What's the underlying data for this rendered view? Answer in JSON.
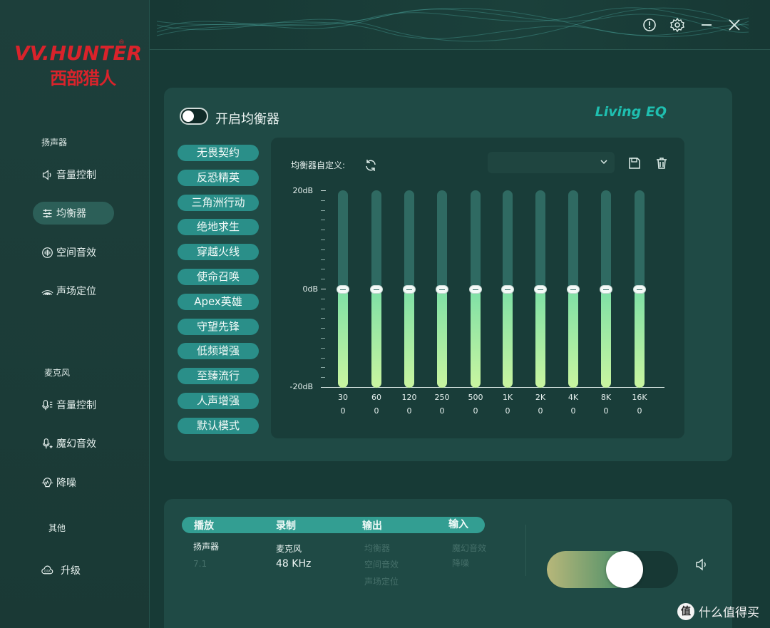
{
  "brand": {
    "logo_en": "VV.HUNTER",
    "logo_cn": "西部猎人",
    "logo_reg": "®",
    "color": "#d9232b"
  },
  "sidebar": {
    "speaker_section": "扬声器",
    "speaker_items": [
      {
        "label": "音量控制",
        "icon": "speaker-icon"
      },
      {
        "label": "均衡器",
        "icon": "equalizer-icon",
        "active": true
      },
      {
        "label": "空间音效",
        "icon": "spatial-audio-icon"
      },
      {
        "label": "声场定位",
        "icon": "sound-field-icon"
      }
    ],
    "mic_section": "麦克风",
    "mic_items": [
      {
        "label": "音量控制",
        "icon": "mic-volume-icon"
      },
      {
        "label": "魔幻音效",
        "icon": "magic-voice-icon"
      },
      {
        "label": "降噪",
        "icon": "noise-reduction-icon"
      }
    ],
    "other_section": "其他",
    "other_items": [
      {
        "label": "升级",
        "icon": "cloud-upgrade-icon"
      }
    ]
  },
  "topbar": {
    "icons": [
      "info-icon",
      "settings-icon",
      "minimize-icon",
      "close-icon"
    ]
  },
  "equalizer": {
    "enable_label": "开启均衡器",
    "enabled": false,
    "brand_label": "Living EQ",
    "presets": [
      "无畏契约",
      "反恐精英",
      "三角洲行动",
      "绝地求生",
      "穿越火线",
      "使命召唤",
      "Apex英雄",
      "守望先锋",
      "低频增强",
      "至臻流行",
      "人声增强",
      "默认模式"
    ],
    "custom_label": "均衡器自定义:",
    "custom_select_value": "",
    "db_max": "20dB",
    "db_mid": "0dB",
    "db_min": "-20dB",
    "bands": [
      {
        "freq": "30",
        "gain": "0"
      },
      {
        "freq": "60",
        "gain": "0"
      },
      {
        "freq": "120",
        "gain": "0"
      },
      {
        "freq": "250",
        "gain": "0"
      },
      {
        "freq": "500",
        "gain": "0"
      },
      {
        "freq": "1K",
        "gain": "0"
      },
      {
        "freq": "2K",
        "gain": "0"
      },
      {
        "freq": "4K",
        "gain": "0"
      },
      {
        "freq": "8K",
        "gain": "0"
      },
      {
        "freq": "16K",
        "gain": "0"
      }
    ]
  },
  "status": {
    "tabs": [
      "播放",
      "录制",
      "输出",
      "输入"
    ],
    "playback_device": "扬声器",
    "playback_channels": "7.1",
    "record_device": "麦克风",
    "record_rate": "48 KHz",
    "output_items": [
      "均衡器",
      "空间音效",
      "声场定位"
    ],
    "input_items": [
      "魔幻音效",
      "降噪"
    ],
    "volume_fraction": 0.52
  },
  "watermark": {
    "mark": "值",
    "text": "什么值得买"
  }
}
